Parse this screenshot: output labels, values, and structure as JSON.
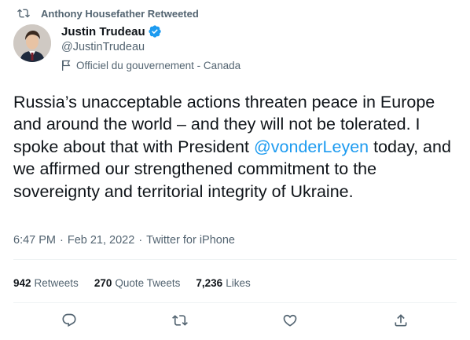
{
  "retweet_header": {
    "text": "Anthony Housefather Retweeted",
    "icon": "retweet-icon"
  },
  "author": {
    "name": "Justin Trudeau",
    "handle": "@JustinTrudeau",
    "verified": true,
    "label": "Officiel du gouvernement - Canada",
    "label_icon": "government-flag-icon"
  },
  "tweet": {
    "text_before": "Russia’s unacceptable actions threaten peace in Europe and around the world – and they will not be tolerated. I spoke about that with President ",
    "mention": "@vonderLeyen",
    "text_after": " today, and we affirmed our strengthened commitment to the sovereignty and territorial integrity of Ukraine."
  },
  "meta": {
    "time": "6:47 PM",
    "separator": "·",
    "date": "Feb 21, 2022",
    "source": "Twitter for iPhone"
  },
  "stats": {
    "retweets_count": "942",
    "retweets_label": "Retweets",
    "quotes_count": "270",
    "quotes_label": "Quote Tweets",
    "likes_count": "7,236",
    "likes_label": "Likes"
  },
  "actions": [
    "reply-icon",
    "retweet-icon",
    "like-icon",
    "share-icon"
  ],
  "colors": {
    "text": "#0f1419",
    "secondary": "#536471",
    "accent": "#1d9bf0",
    "divider": "#eff3f4"
  }
}
